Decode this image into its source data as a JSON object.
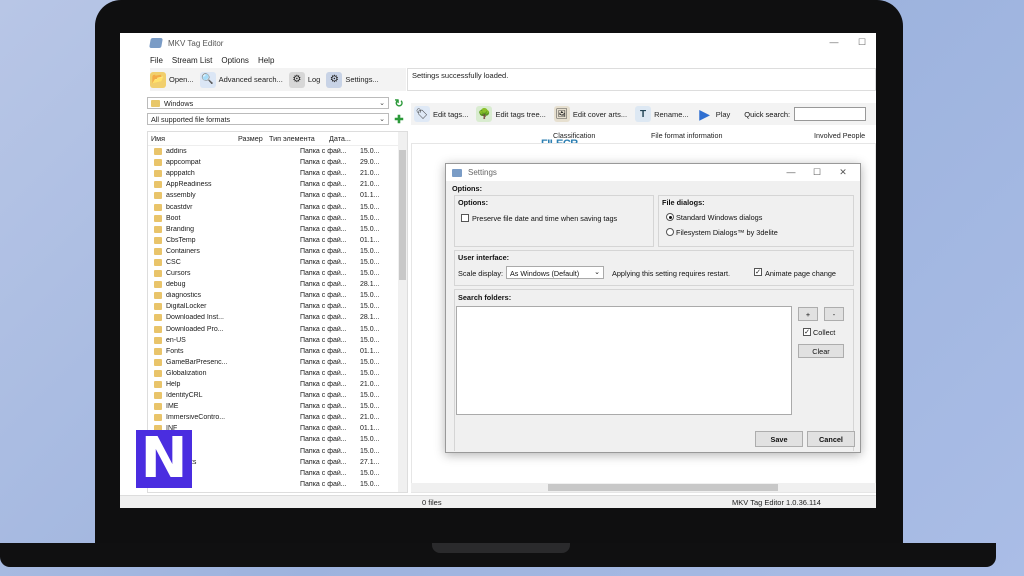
{
  "window": {
    "title": "MKV Tag Editor",
    "minimize": "—",
    "maximize": "☐"
  },
  "menu": [
    "File",
    "Stream List",
    "Options",
    "Help"
  ],
  "toolbar_left": [
    {
      "label": "Open...",
      "icon": "folder-open-icon",
      "glyph": "📂",
      "color": "#f1cf6d"
    },
    {
      "label": "Advanced search...",
      "icon": "magnifier-icon",
      "glyph": "🔍",
      "color": "#dbe6f5"
    },
    {
      "label": "Log",
      "icon": "log-icon",
      "glyph": "⚙",
      "color": "#d7d7d7"
    },
    {
      "label": "Settings...",
      "icon": "settings-gear-icon",
      "glyph": "⚙",
      "color": "#c8d3e6"
    }
  ],
  "status_message": "Settings successfully loaded.",
  "folder_combo": "Windows",
  "format_combo": "All supported file formats",
  "file_list": {
    "columns": [
      "Имя",
      "Размер",
      "Тип элемента",
      "Дата..."
    ],
    "rows": [
      {
        "name": "addins",
        "type": "Папка с фай...",
        "date": "15.0..."
      },
      {
        "name": "appcompat",
        "type": "Папка с фай...",
        "date": "29.0..."
      },
      {
        "name": "apppatch",
        "type": "Папка с фай...",
        "date": "21.0..."
      },
      {
        "name": "AppReadiness",
        "type": "Папка с фай...",
        "date": "21.0..."
      },
      {
        "name": "assembly",
        "type": "Папка с фай...",
        "date": "01.1..."
      },
      {
        "name": "bcastdvr",
        "type": "Папка с фай...",
        "date": "15.0..."
      },
      {
        "name": "Boot",
        "type": "Папка с фай...",
        "date": "15.0..."
      },
      {
        "name": "Branding",
        "type": "Папка с фай...",
        "date": "15.0..."
      },
      {
        "name": "CbsTemp",
        "type": "Папка с фай...",
        "date": "01.1..."
      },
      {
        "name": "Containers",
        "type": "Папка с фай...",
        "date": "15.0..."
      },
      {
        "name": "CSC",
        "type": "Папка с фай...",
        "date": "15.0..."
      },
      {
        "name": "Cursors",
        "type": "Папка с фай...",
        "date": "15.0..."
      },
      {
        "name": "debug",
        "type": "Папка с фай...",
        "date": "28.1..."
      },
      {
        "name": "diagnostics",
        "type": "Папка с фай...",
        "date": "15.0..."
      },
      {
        "name": "DigitalLocker",
        "type": "Папка с фай...",
        "date": "15.0..."
      },
      {
        "name": "Downloaded Inst...",
        "type": "Папка с фай...",
        "date": "28.1..."
      },
      {
        "name": "Downloaded Pro...",
        "type": "Папка с фай...",
        "date": "15.0..."
      },
      {
        "name": "en-US",
        "type": "Папка с фай...",
        "date": "15.0..."
      },
      {
        "name": "Fonts",
        "type": "Папка с фай...",
        "date": "01.1..."
      },
      {
        "name": "GameBarPresenc...",
        "type": "Папка с фай...",
        "date": "15.0..."
      },
      {
        "name": "Globalization",
        "type": "Папка с фай...",
        "date": "15.0..."
      },
      {
        "name": "Help",
        "type": "Папка с фай...",
        "date": "21.0..."
      },
      {
        "name": "IdentityCRL",
        "type": "Папка с фай...",
        "date": "15.0..."
      },
      {
        "name": "IME",
        "type": "Папка с фай...",
        "date": "15.0..."
      },
      {
        "name": "ImmersiveContro...",
        "type": "Папка с фай...",
        "date": "21.0..."
      },
      {
        "name": "INF",
        "type": "Папка с фай...",
        "date": "01.1..."
      },
      {
        "name": "...hod",
        "type": "Папка с фай...",
        "date": "15.0..."
      },
      {
        "name": "...s",
        "type": "Папка с фай...",
        "date": "15.0..."
      },
      {
        "name": "...Reports",
        "type": "Папка с фай...",
        "date": "27.1..."
      },
      {
        "name": "",
        "type": "Папка с фай...",
        "date": "15.0..."
      },
      {
        "name": "m...",
        "type": "Папка с фай...",
        "date": "15.0..."
      }
    ]
  },
  "toolbar_right": [
    {
      "label": "Edit tags...",
      "icon": "tag-icon",
      "glyph": "🏷",
      "color": "#dfe9f6"
    },
    {
      "label": "Edit tags tree...",
      "icon": "tree-icon",
      "glyph": "🌳",
      "color": "#d9ecd0"
    },
    {
      "label": "Edit cover arts...",
      "icon": "cover-art-icon",
      "glyph": "🖼",
      "color": "#e7e0d0"
    },
    {
      "label": "Rename...",
      "icon": "rename-icon",
      "glyph": "T",
      "color": "#dde8f3"
    },
    {
      "label": "Play",
      "icon": "play-icon",
      "glyph": "▶",
      "color": "#f3f3f3"
    }
  ],
  "quick_search_label": "Quick search:",
  "grid_columns": [
    "Classification",
    "File format information",
    "Involved People"
  ],
  "watermark": "FILECR",
  "status_files": "0 files",
  "status_version": "MKV Tag Editor 1.0.36.114",
  "dialog": {
    "title": "Settings",
    "options_header": "Options:",
    "options_group": "Options:",
    "preserve_label": "Preserve file date and time when saving tags",
    "file_dialogs_group": "File dialogs:",
    "radio_standard": "Standard Windows dialogs",
    "radio_filesystem": "Filesystem Dialogs™ by 3delite",
    "ui_group": "User interface:",
    "scale_label": "Scale display:",
    "scale_value": "As Windows (Default)",
    "restart_note": "Applying this setting requires restart.",
    "animate_label": "Animate page change",
    "search_group": "Search folders:",
    "add_btn": "+",
    "remove_btn": "-",
    "collect_label": "Collect",
    "clear_btn": "Clear",
    "save_btn": "Save",
    "cancel_btn": "Cancel"
  },
  "logo": "N"
}
